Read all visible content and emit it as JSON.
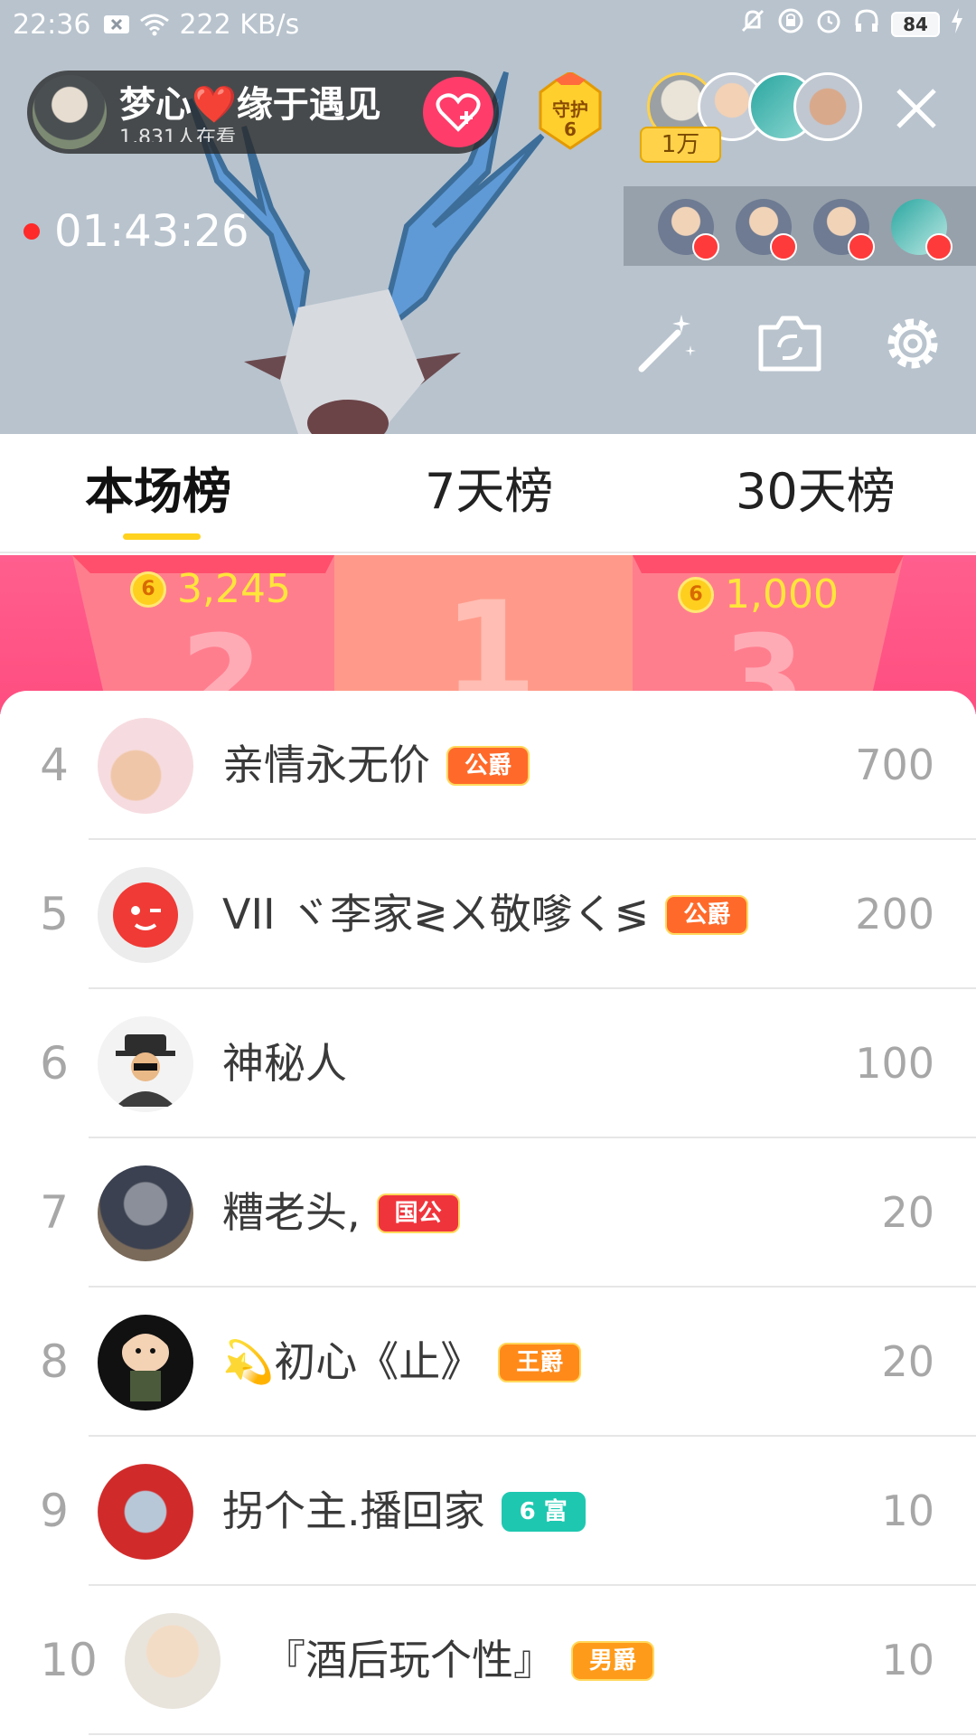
{
  "status_bar": {
    "time": "22:36",
    "network_speed": "222 KB/s",
    "battery": "84",
    "icons": [
      "notification-x-icon",
      "wifi-icon",
      "mute-bell-icon",
      "lock-rotation-icon",
      "alarm-icon",
      "headphones-icon",
      "battery-icon",
      "charging-icon"
    ]
  },
  "host": {
    "name": "梦心❤️缘于遇见",
    "subtitle": "1,831人在看",
    "follow_icon": "heart-plus-icon"
  },
  "guard": {
    "label": "守护",
    "count": "6"
  },
  "viewers": {
    "count_label": "1万"
  },
  "stream": {
    "elapsed": "01:43:26"
  },
  "tools": [
    "magic-wand-icon",
    "camera-flip-icon",
    "settings-icon"
  ],
  "tabs": [
    {
      "label": "本场榜",
      "active": true
    },
    {
      "label": "7天榜",
      "active": false
    },
    {
      "label": "30天榜",
      "active": false
    }
  ],
  "podium": {
    "second": {
      "score": "3,245",
      "place": "2"
    },
    "first": {
      "place": "1"
    },
    "third": {
      "score": "1,000",
      "place": "3"
    }
  },
  "rankings": [
    {
      "rank": "4",
      "name": "亲情永无价",
      "badge": "公爵",
      "badge_color": "#ff6a2a",
      "score": "700"
    },
    {
      "rank": "5",
      "name": "VII ヾ李家≷ㄨ敬嗲く≶",
      "badge": "公爵",
      "badge_color": "#ff6a2a",
      "score": "200"
    },
    {
      "rank": "6",
      "name": "神秘人",
      "badge": "",
      "badge_color": "",
      "score": "100"
    },
    {
      "rank": "7",
      "name": "糟老头,",
      "badge": "国公",
      "badge_color": "#f0343c",
      "score": "20"
    },
    {
      "rank": "8",
      "name": "💫初心《止》",
      "badge": "王爵",
      "badge_color": "#ff8a1a",
      "score": "20"
    },
    {
      "rank": "9",
      "name": "拐个主.播回家",
      "badge": "6 富",
      "badge_color": "#1ec8b0",
      "score": "10"
    },
    {
      "rank": "10",
      "name": "『酒后玩个性』",
      "badge": "男爵",
      "badge_color": "#ff9b1a",
      "score": "10"
    }
  ]
}
